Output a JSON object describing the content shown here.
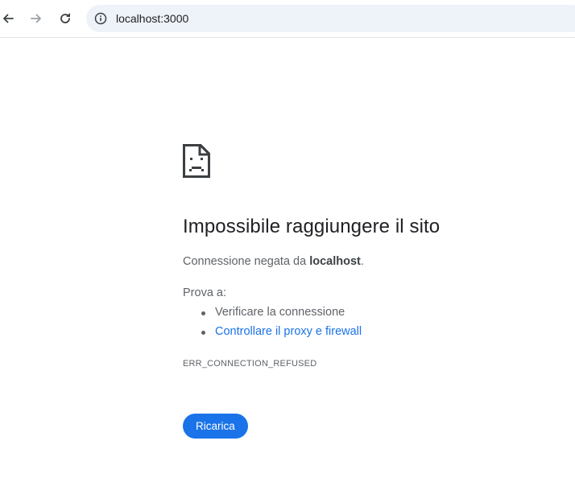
{
  "browser": {
    "url": "localhost:3000",
    "icons": {
      "back": "arrow-left-icon",
      "forward": "arrow-right-icon",
      "reload": "reload-icon",
      "site_info": "info-icon"
    }
  },
  "error_page": {
    "icon": "sad-page-icon",
    "title": "Impossibile raggiungere il sito",
    "refused_prefix": "Connessione negata da ",
    "refused_host": "localhost",
    "refused_suffix": ".",
    "try_label": "Prova a:",
    "suggestions": [
      {
        "text": "Verificare la connessione",
        "link": false
      },
      {
        "text": "Controllare il proxy e firewall",
        "link": true
      }
    ],
    "error_code": "ERR_CONNECTION_REFUSED",
    "reload_button": "Ricarica"
  },
  "colors": {
    "accent": "#1a73e8",
    "text_primary": "#202124",
    "text_secondary": "#5f6368",
    "omnibox_bg": "#eef2f9"
  }
}
